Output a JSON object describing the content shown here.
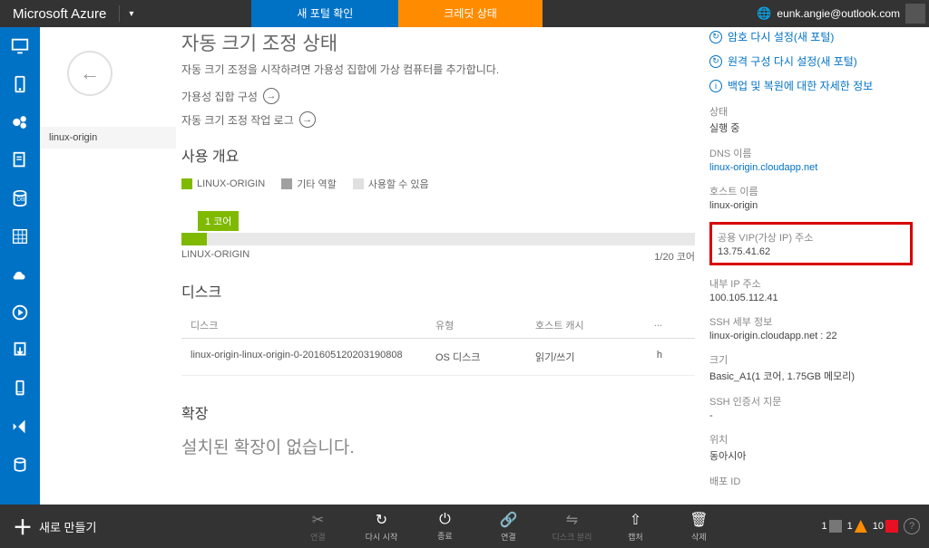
{
  "topbar": {
    "brand": "Microsoft Azure",
    "btn_blue": "새 포털 확인",
    "btn_orange": "크레딧 상태",
    "user": "eunk.angie@outlook.com"
  },
  "breadcrumb": {
    "crumb": "linux-origin"
  },
  "main": {
    "autoscale_h": "자동 크기 조정 상태",
    "autoscale_desc": "자동 크기 조정을 시작하려면 가용성 집합에 가상 컴퓨터를 추가합니다.",
    "link_availset": "가용성 집합 구성",
    "link_autoscalelog": "자동 크기 조정 작업 로그",
    "usage_h": "사용 개요",
    "legend": {
      "a": "LINUX-ORIGIN",
      "b": "기타 역할",
      "c": "사용할 수 있음"
    },
    "bar_label": "1 코어",
    "bar_left": "LINUX-ORIGIN",
    "bar_right": "1/20 코어",
    "disk_h": "디스크",
    "disk_th": {
      "c1": "디스크",
      "c2": "유형",
      "c3": "호스트 캐시",
      "c4": "..."
    },
    "disk_row": {
      "c1": "linux-origin-linux-origin-0-201605120203190808",
      "c2": "OS 디스크",
      "c3": "읽기/쓰기",
      "c4": "h"
    },
    "ext_h": "확장",
    "ext_desc": "설치된 확장이 없습니다."
  },
  "right": {
    "q1": "암호 다시 설정(새 포털)",
    "q2": "원격 구성 다시 설정(새 포털)",
    "q3": "백업 및 복원에 대한 자세한 정보",
    "p_status": {
      "label": "상태",
      "value": "실행 중"
    },
    "p_dns": {
      "label": "DNS 이름",
      "value": "linux-origin.cloudapp.net"
    },
    "p_host": {
      "label": "호스트 이름",
      "value": "linux-origin"
    },
    "p_vip": {
      "label": "공용 VIP(가상 IP) 주소",
      "value": "13.75.41.62"
    },
    "p_intip": {
      "label": "내부 IP 주소",
      "value": "100.105.112.41"
    },
    "p_ssh": {
      "label": "SSH 세부 정보",
      "value": "linux-origin.cloudapp.net : 22"
    },
    "p_size": {
      "label": "크기",
      "value": "Basic_A1(1 코어, 1.75GB 메모리)"
    },
    "p_fp": {
      "label": "SSH 인증서 지문",
      "value": "-"
    },
    "p_loc": {
      "label": "위치",
      "value": "동아시아"
    },
    "p_dep": {
      "label": "배포 ID"
    }
  },
  "bottom": {
    "new": "새로 만들기",
    "actions": {
      "connect1": "연결",
      "restart": "다시 시작",
      "shutdown": "종료",
      "connect2": "연결",
      "detach": "디스크 분리",
      "capture": "캡처",
      "delete": "삭제"
    },
    "status": {
      "n1": "1",
      "n2": "1",
      "n3": "10"
    }
  }
}
